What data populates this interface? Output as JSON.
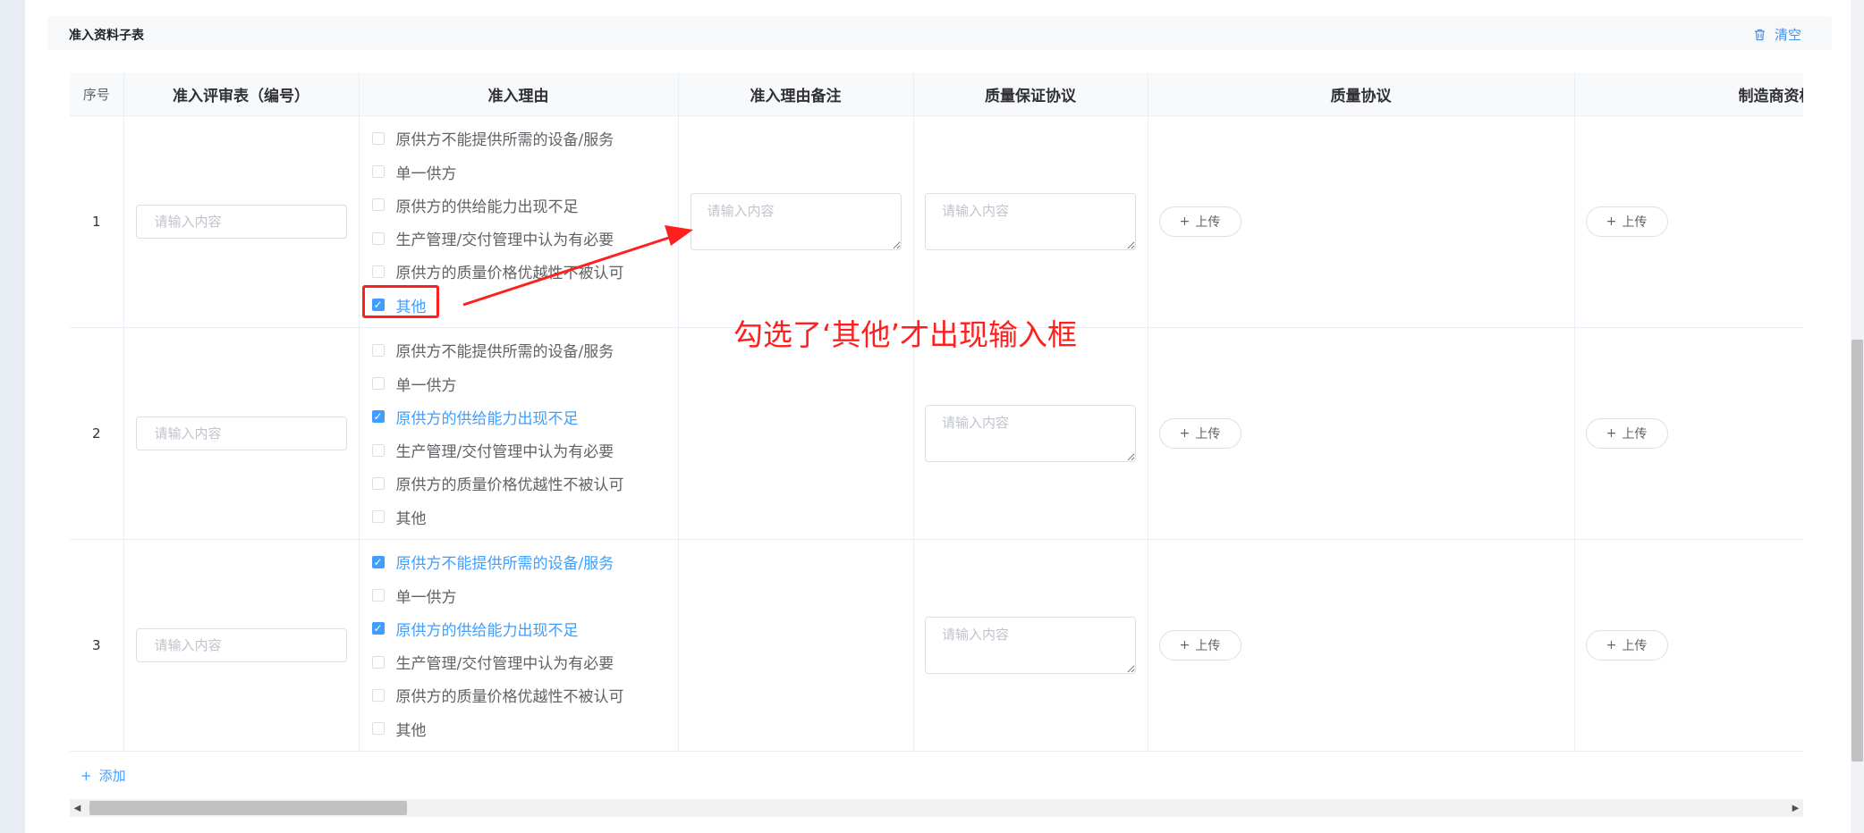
{
  "section": {
    "title": "准入资料子表",
    "clear_label": "清空"
  },
  "columns": [
    "序号",
    "准入评审表（编号）",
    "准入理由",
    "准入理由备注",
    "质量保证协议",
    "质量协议",
    "制造商资格"
  ],
  "placeholder": "请输入内容",
  "upload_label": "上传",
  "add_label": "添加",
  "annotation": "勾选了‘其他’才出现输入框",
  "colors": {
    "accent": "#409eff",
    "annotation": "#ff1f1f"
  },
  "rows": [
    {
      "index": "1",
      "reasons": [
        {
          "label": "原供方不能提供所需的设备/服务",
          "checked": false
        },
        {
          "label": "单一供方",
          "checked": false
        },
        {
          "label": "原供方的供给能力出现不足",
          "checked": false
        },
        {
          "label": "生产管理/交付管理中认为有必要",
          "checked": false
        },
        {
          "label": "原供方的质量价格优越性不被认可",
          "checked": false
        },
        {
          "label": "其他",
          "checked": true
        }
      ],
      "has_remark_input": true
    },
    {
      "index": "2",
      "reasons": [
        {
          "label": "原供方不能提供所需的设备/服务",
          "checked": false
        },
        {
          "label": "单一供方",
          "checked": false
        },
        {
          "label": "原供方的供给能力出现不足",
          "checked": true
        },
        {
          "label": "生产管理/交付管理中认为有必要",
          "checked": false
        },
        {
          "label": "原供方的质量价格优越性不被认可",
          "checked": false
        },
        {
          "label": "其他",
          "checked": false
        }
      ],
      "has_remark_input": false
    },
    {
      "index": "3",
      "reasons": [
        {
          "label": "原供方不能提供所需的设备/服务",
          "checked": true
        },
        {
          "label": "单一供方",
          "checked": false
        },
        {
          "label": "原供方的供给能力出现不足",
          "checked": true
        },
        {
          "label": "生产管理/交付管理中认为有必要",
          "checked": false
        },
        {
          "label": "原供方的质量价格优越性不被认可",
          "checked": false
        },
        {
          "label": "其他",
          "checked": false
        }
      ],
      "has_remark_input": false
    }
  ]
}
